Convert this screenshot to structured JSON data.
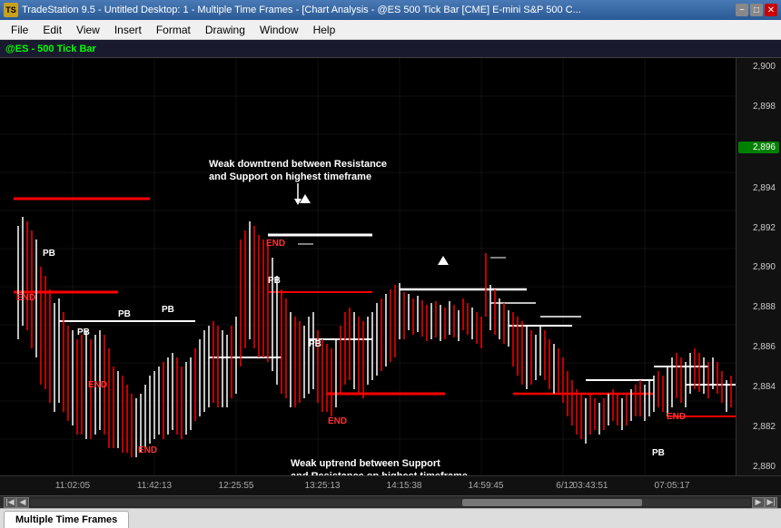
{
  "titleBar": {
    "iconLabel": "TS",
    "title": "TradeStation 9.5 - Untitled Desktop: 1 - Multiple Time Frames - [Chart Analysis - @ES 500 Tick Bar [CME] E-mini S&P 500 C...",
    "minButton": "−",
    "maxButton": "□",
    "closeButton": "✕"
  },
  "menuBar": {
    "items": [
      "File",
      "Edit",
      "View",
      "Insert",
      "Format",
      "Drawing",
      "Window",
      "Help"
    ]
  },
  "symbolBar": {
    "label": "@ES - 500 Tick Bar"
  },
  "priceAxis": {
    "prices": [
      "2,900",
      "2,898",
      "2,896",
      "2,894",
      "2,892",
      "2,890",
      "2,888",
      "2,886",
      "2,884",
      "2,882",
      "2,880"
    ],
    "highlightedPrice": "2,896",
    "highlightColor": "#008000"
  },
  "timeAxis": {
    "labels": [
      "11:02:05",
      "11:42:13",
      "12:25:55",
      "13:25:13",
      "14:15:38",
      "14:59:45",
      "6/12",
      "03:43:51",
      "07:05:17"
    ]
  },
  "annotations": {
    "weakDowntrend": "Weak downtrend between Resistance\nand Support on highest timeframe",
    "weakUptrend": "Weak uptrend between Support\nand Resistance on highest timeframe",
    "pbLabels": [
      "PB",
      "PB",
      "PB",
      "PB",
      "PB",
      "PB"
    ],
    "endLabels": [
      "END",
      "END",
      "END",
      "END",
      "END",
      "END"
    ]
  },
  "tabs": {
    "items": [
      "Multiple Time Frames"
    ],
    "activeTab": "Multiple Time Frames"
  },
  "scrollBar": {
    "leftArrow": "◀",
    "rightArrow": "▶",
    "firstArrow": "|◀",
    "lastArrow": "▶|"
  }
}
